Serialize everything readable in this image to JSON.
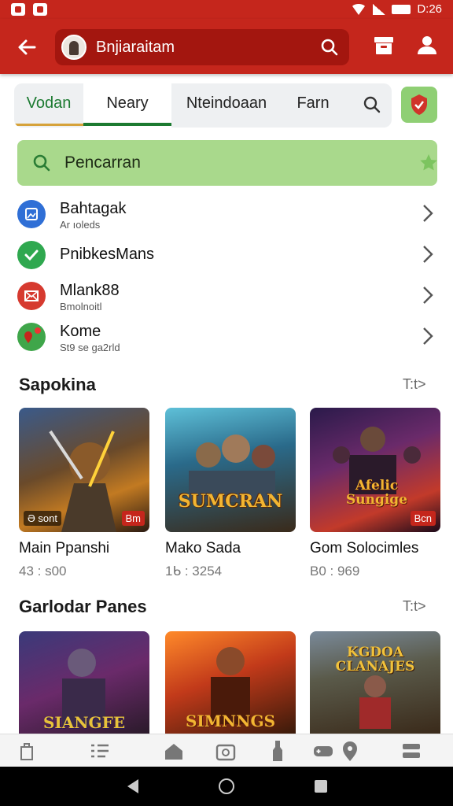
{
  "status_bar": {
    "time": "D:26"
  },
  "app_bar": {
    "search_title": "Bnjiaraitam"
  },
  "tabs": [
    {
      "label": "Vodan",
      "active": false
    },
    {
      "label": "Neary",
      "active": true
    },
    {
      "label": "Nteindoaan",
      "active": false
    },
    {
      "label": "Farn",
      "active": false
    }
  ],
  "search": {
    "placeholder": "Pencarran"
  },
  "list": [
    {
      "title": "Bahtagak",
      "subtitle": "Ar ıoleds",
      "icon": "image-icon",
      "color": "#2f6fd6"
    },
    {
      "title": "PnibkesMans",
      "subtitle": "",
      "icon": "check-icon",
      "color": "#2fa84f"
    },
    {
      "title": "Mlank88",
      "subtitle": "Bmolnoitl",
      "icon": "mail-icon",
      "color": "#d63a2f"
    },
    {
      "title": "Kome",
      "subtitle": "St9 se ga2rld",
      "icon": "map-pin-icon",
      "color": "#3fa64a"
    }
  ],
  "section1": {
    "title": "Sapokina",
    "more": "T:t>",
    "cards": [
      {
        "title": "Main Ppanshi",
        "stat": "43 : s00",
        "badge_left": "Ə sont",
        "badge_right": "Bm"
      },
      {
        "title": "Mako Sada",
        "stat": "1ᑲ : 3254",
        "art_text": "SUMCRAN"
      },
      {
        "title": "Gom Solocimles",
        "stat": "B0 : 969",
        "art_text": "Afelic Sungige",
        "badge_right": "Bcn"
      }
    ]
  },
  "section2": {
    "title": "Garlodar Panes",
    "more": "T:t>",
    "cards": [
      {
        "art_text": "SIANGFE"
      },
      {
        "art_text": "SIMNNGS"
      },
      {
        "art_text": "KGDOA CLANAJES"
      }
    ]
  },
  "colors": {
    "brand": "#c5261c",
    "accent_green": "#1c7a31",
    "search_bg": "#a9d98c"
  }
}
